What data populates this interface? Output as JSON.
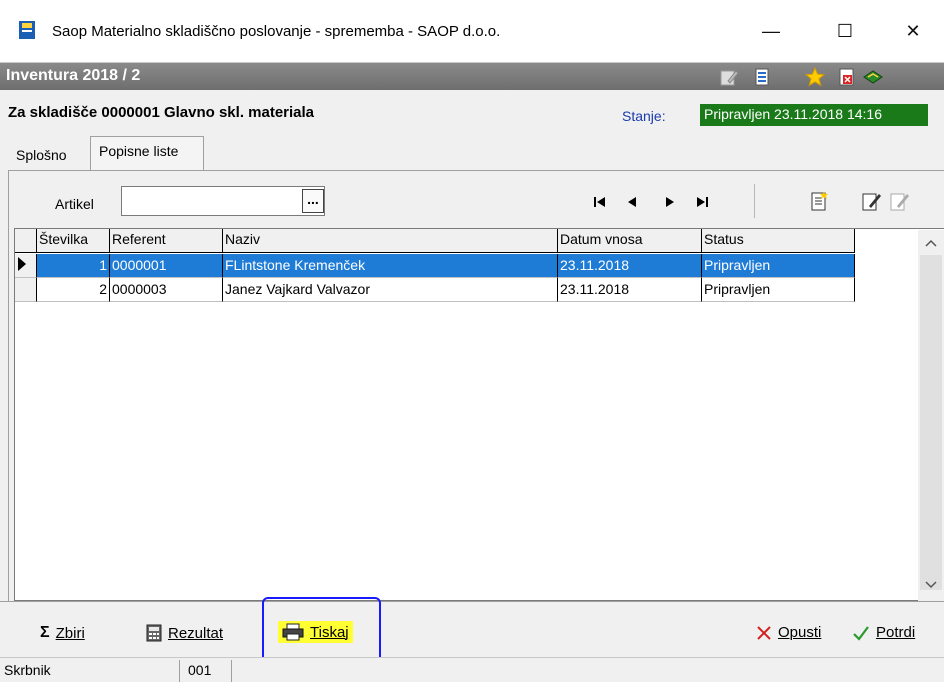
{
  "window": {
    "title": "Saop Materialno skladiščno poslovanje - sprememba - SAOP d.o.o.",
    "min": "—",
    "max": "☐",
    "close": "✕"
  },
  "header": {
    "title": "Inventura 2018 / 2",
    "warehouse": "Za skladišče 0000001 Glavno skl. materiala",
    "stanje_label": "Stanje:",
    "stanje_value": "Pripravljen 23.11.2018 14:16",
    "stanje_color": "#1a7a1a"
  },
  "tabs": [
    {
      "label": "Splošno"
    },
    {
      "label": "Popisne liste"
    }
  ],
  "toolbar": {
    "artikel_label": "Artikel",
    "artikel_value": "",
    "dots": "..."
  },
  "grid": {
    "columns": [
      "Številka",
      "Referent",
      "Naziv",
      "Datum vnosa",
      "Status"
    ],
    "rows": [
      {
        "stevilka": "1",
        "referent": "0000001",
        "naziv": "FLintstone Kremenček",
        "datum": "23.11.2018",
        "status": "Pripravljen"
      },
      {
        "stevilka": "2",
        "referent": "0000003",
        "naziv": "Janez Vajkard Valvazor",
        "datum": "23.11.2018",
        "status": "Pripravljen"
      }
    ],
    "selected_row": 0,
    "selection_color": "#1e7bd6"
  },
  "buttons": {
    "zbiri": "Zbiri",
    "rezultat": "Rezultat",
    "tiskaj": "Tiskaj",
    "opusti": "Opusti",
    "potrdi": "Potrdi"
  },
  "statusbar": {
    "user": "Skrbnik",
    "code": "001"
  },
  "highlight_color": "#ffff33"
}
